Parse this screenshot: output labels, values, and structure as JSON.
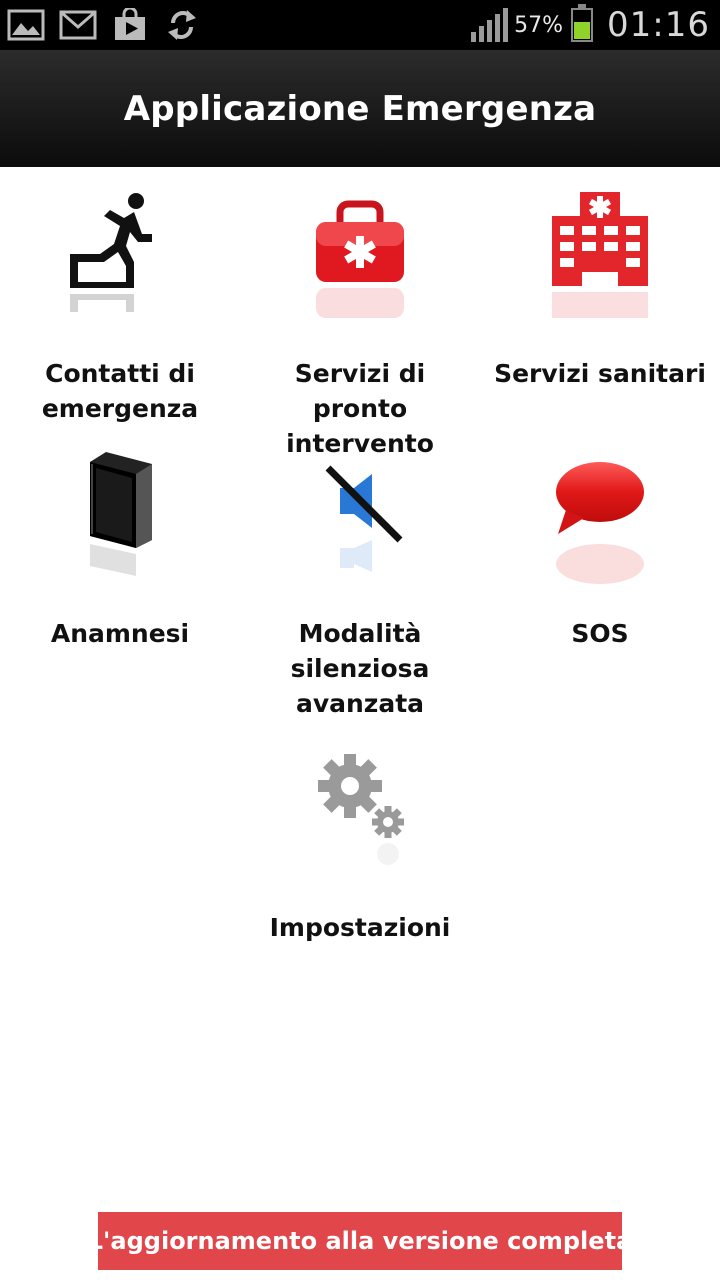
{
  "status_bar": {
    "icons": [
      "image-icon",
      "gmail-icon",
      "play-store-icon",
      "sync-icon"
    ],
    "battery_text": "57%",
    "battery_level": 0.57,
    "time": "01:16"
  },
  "header": {
    "title": "Applicazione Emergenza"
  },
  "menu": {
    "items": [
      {
        "label": "Contatti di emergenza",
        "icon": "running-man-exit-icon"
      },
      {
        "label": "Servizi di pronto intervento",
        "icon": "first-aid-kit-icon"
      },
      {
        "label": "Servizi sanitari",
        "icon": "hospital-icon"
      },
      {
        "label": "Anamnesi",
        "icon": "book-icon"
      },
      {
        "label": "Modalità silenziosa avanzata",
        "icon": "mute-speaker-icon"
      },
      {
        "label": "SOS",
        "icon": "speech-bubble-icon"
      },
      {
        "label": "Impostazioni",
        "icon": "gears-icon"
      }
    ]
  },
  "upgrade_banner": {
    "label": "L'aggiornamento alla versione completa"
  },
  "colors": {
    "accent_red": "#e0464a",
    "battery_green": "#8fd22a",
    "titlebar": "#1a1a1a"
  }
}
